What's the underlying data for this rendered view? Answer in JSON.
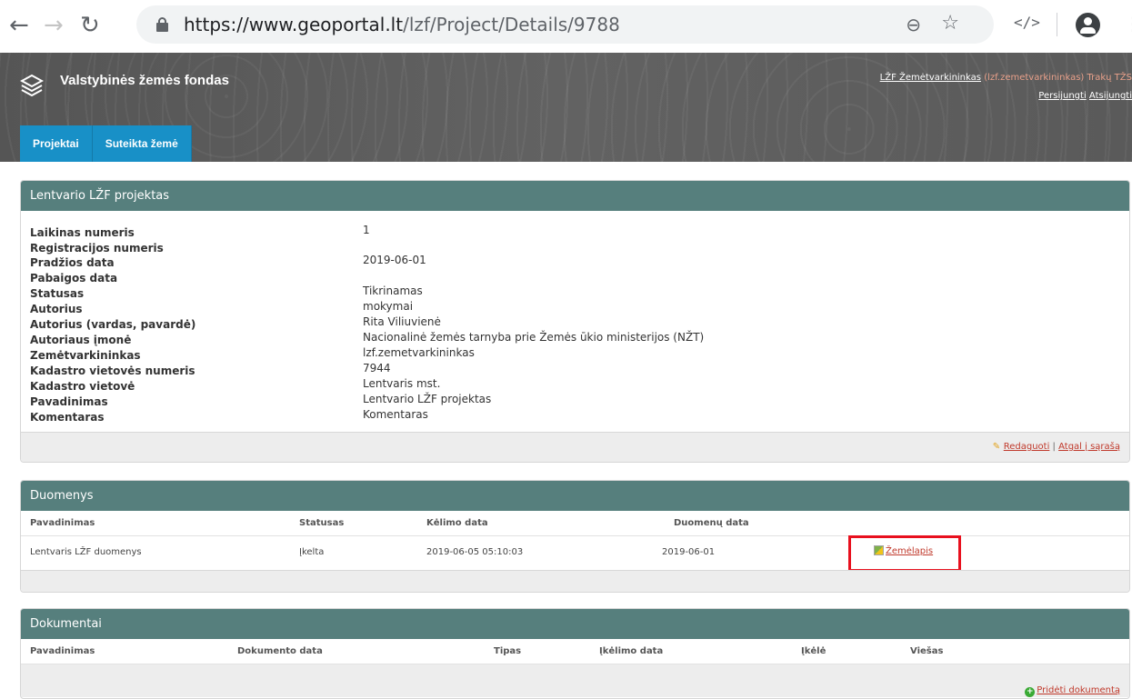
{
  "browser": {
    "url_host": "https://www.geoportal.lt",
    "url_path": "/lzf/Project/Details/9788"
  },
  "header": {
    "app_title": "Valstybinės žemės fondas",
    "user_name": "LŽF Žemėtvarkininkas",
    "user_extra": " (lzf.zemetvarkininkas) Trakų TŽS",
    "reconnect": "Persijungti",
    "logout": "Atsijungti",
    "tabs": [
      {
        "label": "Projektai"
      },
      {
        "label": "Suteikta žemė"
      }
    ]
  },
  "details": {
    "title": "Lentvario LŽF projektas",
    "rows": [
      {
        "label": "Laikinas numeris",
        "value": "1"
      },
      {
        "label": "Registracijos numeris",
        "value": ""
      },
      {
        "label": "Pradžios data",
        "value": "2019-06-01"
      },
      {
        "label": "Pabaigos data",
        "value": ""
      },
      {
        "label": "Statusas",
        "value": "Tikrinamas"
      },
      {
        "label": "Autorius",
        "value": "mokymai"
      },
      {
        "label": "Autorius (vardas, pavardė)",
        "value": "Rita Viliuvienė"
      },
      {
        "label": "Autoriaus įmonė",
        "value": "Nacionalinė žemės tarnyba prie Žemės ūkio ministerijos (NŽT)"
      },
      {
        "label": "Zemėtvarkininkas",
        "value": "lzf.zemetvarkininkas"
      },
      {
        "label": "Kadastro vietovės numeris",
        "value": "7944"
      },
      {
        "label": "Kadastro vietovė",
        "value": "Lentvaris mst."
      },
      {
        "label": "Pavadinimas",
        "value": "Lentvario LŽF projektas"
      },
      {
        "label": "Komentaras",
        "value": "Komentaras"
      }
    ],
    "edit": "Redaguoti",
    "separator": " | ",
    "back": "Atgal į sąrašą"
  },
  "duomenys": {
    "title": "Duomenys",
    "columns": [
      "Pavadinimas",
      "Statusas",
      "Kėlimo data",
      "Duomenų data"
    ],
    "rows": [
      {
        "name": "Lentvaris LŽF duomenys",
        "status": "Įkelta",
        "upload_date": "2019-06-05 05:10:03",
        "data_date": "2019-06-01",
        "map_link": "Žemėlapis"
      }
    ]
  },
  "dokumentai": {
    "title": "Dokumentai",
    "columns": [
      "Pavadinimas",
      "Dokumento data",
      "Tipas",
      "Įkėlimo data",
      "Įkėlė",
      "Viešas"
    ],
    "add": "Pridėti dokumentą"
  }
}
